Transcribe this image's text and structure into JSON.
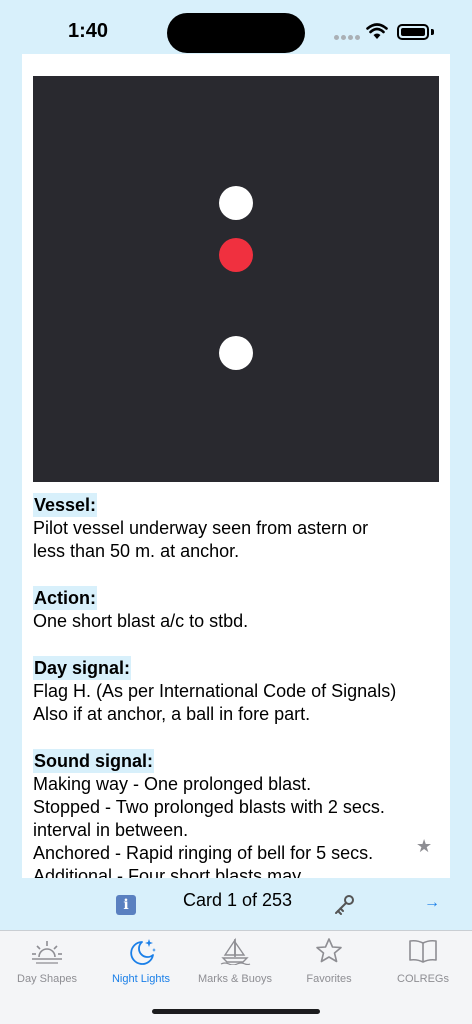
{
  "status_bar": {
    "time": "1:40"
  },
  "card": {
    "lights": [
      {
        "color": "#ffffff",
        "name": "white-light-top"
      },
      {
        "color": "#f0303f",
        "name": "red-light"
      },
      {
        "color": "#ffffff",
        "name": "white-light-bottom"
      }
    ],
    "sections": [
      {
        "heading": "Vessel:",
        "lines": [
          "Pilot vessel underway seen from astern or",
          "less than 50 m. at anchor."
        ]
      },
      {
        "heading": "Action:",
        "lines": [
          "One short blast a/c to stbd."
        ]
      },
      {
        "heading": "Day signal:",
        "lines": [
          "Flag H. (As per International Code of Signals)",
          "Also if at anchor, a ball in fore part."
        ]
      },
      {
        "heading": "Sound signal:",
        "lines": [
          "Making way - One prolonged blast.",
          "Stopped - Two prolonged blasts with 2 secs.",
          "interval in between.",
          "Anchored - Rapid ringing of bell for 5 secs.",
          "Additional - Four short blasts may"
        ]
      }
    ],
    "favorite_icon": "star-icon"
  },
  "toolbar": {
    "info_icon": "info-icon",
    "info_label": "i",
    "card_counter": "Card 1 of 253",
    "key_icon": "key-icon",
    "next_icon": "arrow-right-icon",
    "next_label": "→"
  },
  "tabs": [
    {
      "label": "Day Shapes",
      "icon": "sunrise-icon",
      "active": false
    },
    {
      "label": "Night Lights",
      "icon": "moon-stars-icon",
      "active": true
    },
    {
      "label": "Marks & Buoys",
      "icon": "sailboat-icon",
      "active": false
    },
    {
      "label": "Favorites",
      "icon": "star-icon",
      "active": false
    },
    {
      "label": "COLREGs",
      "icon": "book-icon",
      "active": false
    }
  ],
  "colors": {
    "accent": "#1a7fe8",
    "background": "#d8f0fb",
    "night_panel": "#29292f"
  }
}
